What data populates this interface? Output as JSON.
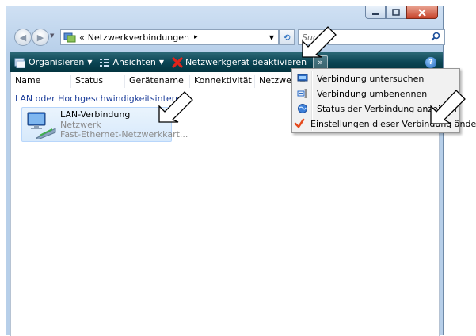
{
  "address": {
    "prefix": "«",
    "path": "Netzwerkverbindungen",
    "separator": "▸"
  },
  "search": {
    "placeholder": "Suchen"
  },
  "toolbar": {
    "organize": "Organisieren",
    "views": "Ansichten",
    "disable": "Netzwerkgerät deaktivieren",
    "more": "»",
    "help": "?"
  },
  "columns": [
    "Name",
    "Status",
    "Gerätename",
    "Konnektivität",
    "Netzwerk"
  ],
  "group": {
    "title": "LAN oder Hochgeschwindigkeitsinternet"
  },
  "item": {
    "name": "LAN-Verbindung",
    "status": "Netzwerk",
    "device": "Fast-Ethernet-Netzwerkkart..."
  },
  "context_menu": {
    "items": [
      {
        "label": "Verbindung untersuchen",
        "icon": "network-diagnose-icon"
      },
      {
        "label": "Verbindung umbenennen",
        "icon": "rename-icon"
      },
      {
        "label": "Status der Verbindung anzeigen",
        "icon": "status-globe-icon"
      },
      {
        "label": "Einstellungen dieser Verbindung ändern",
        "icon": "checkmark-icon"
      }
    ]
  },
  "colors": {
    "toolbar": "#0b4554",
    "group_header": "#1e3f9b",
    "close_button": "#c7432a"
  }
}
